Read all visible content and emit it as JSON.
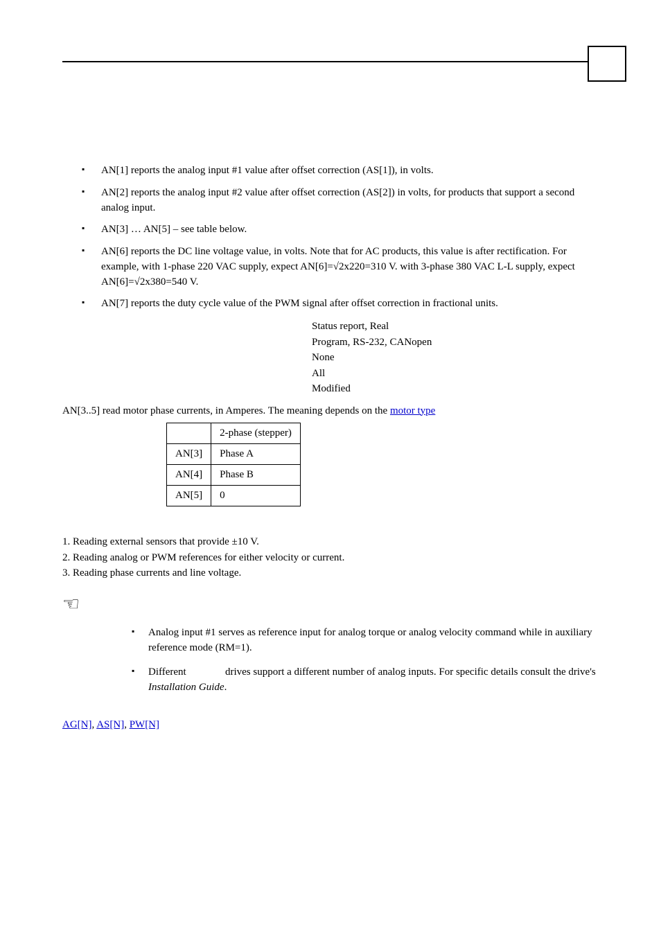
{
  "bullets": [
    "AN[1] reports the analog input #1 value after offset correction (AS[1]), in volts.",
    "AN[2] reports the analog input #2 value after offset correction (AS[2]) in volts, for products that support a second analog input.",
    "AN[3] … AN[5] – see table below.",
    "AN[6] reports the DC line voltage value, in volts. Note that for AC products, this value is after rectification. For example, with 1-phase 220 VAC supply, expect AN[6]=√2x220=310 V. with 3-phase 380 VAC L-L supply, expect AN[6]=√2x380=540 V.",
    "AN[7] reports the duty cycle value of the PWM signal after offset correction in fractional units."
  ],
  "attrs": {
    "l1": "Status report, Real",
    "l2": "Program, RS-232, CANopen",
    "l3": "None",
    "l4": "All",
    "l5": "Modified"
  },
  "motor_sentence_pre": "AN[3..5] read motor phase currents, in Amperes. The meaning depends on the ",
  "motor_link": "motor type",
  "table": {
    "header": [
      "",
      "2-phase (stepper)"
    ],
    "rows": [
      [
        "AN[3]",
        "Phase A"
      ],
      [
        "AN[4]",
        "Phase B"
      ],
      [
        "AN[5]",
        "0"
      ]
    ]
  },
  "numbered": [
    "1. Reading external sensors that provide ±10 V.",
    "2. Reading analog or PWM references for either velocity or current.",
    "3. Reading phase currents and line voltage."
  ],
  "hand_icon": "☞",
  "notes": {
    "n1": "Analog input #1 serves as reference input for analog torque or analog velocity command while in auxiliary reference mode (RM=1).",
    "n2_pre": "Different ",
    "n2_mid": " drives support a different number of analog inputs. For specific details consult the drive's ",
    "n2_em": "Installation Guide",
    "n2_post": "."
  },
  "seealso": {
    "a1": "AG[N]",
    "sep": ", ",
    "a2": "AS[N]",
    "a3": "PW[N]"
  }
}
